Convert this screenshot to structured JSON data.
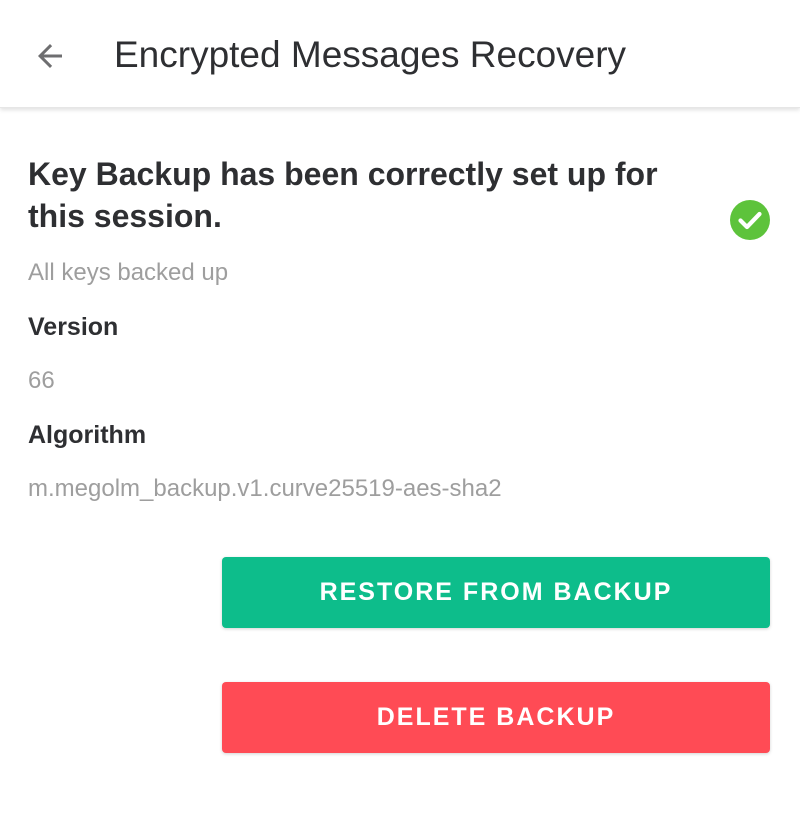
{
  "toolbar": {
    "title": "Encrypted Messages Recovery",
    "back_icon": "arrow-back-icon"
  },
  "status": {
    "heading": "Key Backup has been correctly set up for this session.",
    "subtext": "All keys backed up",
    "icon": "check-circle-icon",
    "icon_color": "#5dc33b"
  },
  "details": {
    "version_label": "Version",
    "version_value": "66",
    "algorithm_label": "Algorithm",
    "algorithm_value": "m.megolm_backup.v1.curve25519-aes-sha2"
  },
  "actions": {
    "restore_label": "RESTORE FROM BACKUP",
    "restore_color": "#0dbd8b",
    "delete_label": "DELETE BACKUP",
    "delete_color": "#ff4b55"
  }
}
